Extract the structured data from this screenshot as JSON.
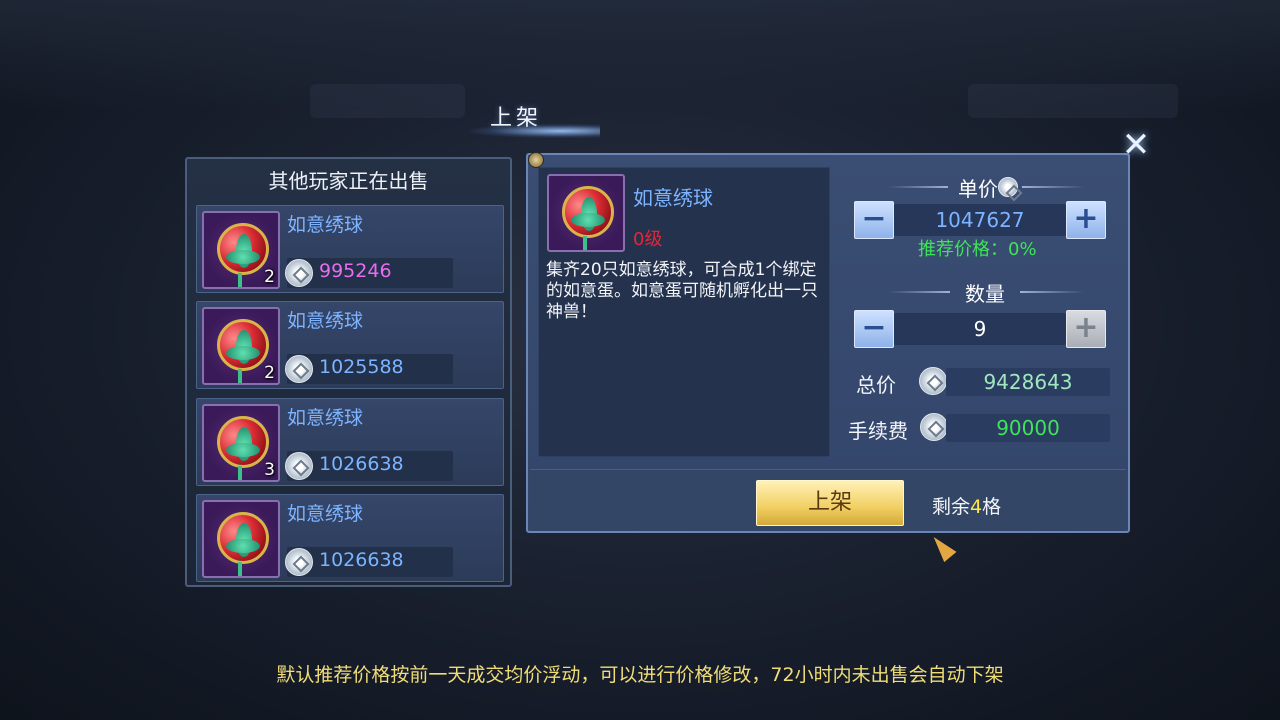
{
  "header": {
    "title": "上架"
  },
  "other_sellers": {
    "title": "其他玩家正在出售",
    "items": [
      {
        "name": "如意绣球",
        "count": "2",
        "price": "995246",
        "price_color": "#e86cf0"
      },
      {
        "name": "如意绣球",
        "count": "2",
        "price": "1025588",
        "price_color": "#7db4ff"
      },
      {
        "name": "如意绣球",
        "count": "3",
        "price": "1026638",
        "price_color": "#7db4ff"
      },
      {
        "name": "如意绣球",
        "count": "",
        "price": "1026638",
        "price_color": "#7db4ff"
      }
    ]
  },
  "item_detail": {
    "name": "如意绣球",
    "level": "0级",
    "description": "集齐20只如意绣球，可合成1个绑定的如意蛋。如意蛋可随机孵化出一只神兽！"
  },
  "pricing": {
    "unit_price_label": "单价",
    "unit_price": "1047627",
    "recommend_text": "推荐价格：0%",
    "quantity_label": "数量",
    "quantity": "9",
    "total_label": "总价",
    "total": "9428643",
    "fee_label": "手续费",
    "fee": "90000"
  },
  "actions": {
    "list_button": "上架",
    "remaining_prefix": "剩余",
    "remaining_count": "4",
    "remaining_suffix": "格"
  },
  "footer": {
    "note": "默认推荐价格按前一天成交均价浮动，可以进行价格修改，72小时内未出售会自动下架"
  },
  "icons": {
    "minus": "−",
    "plus": "+",
    "close": "✕"
  }
}
